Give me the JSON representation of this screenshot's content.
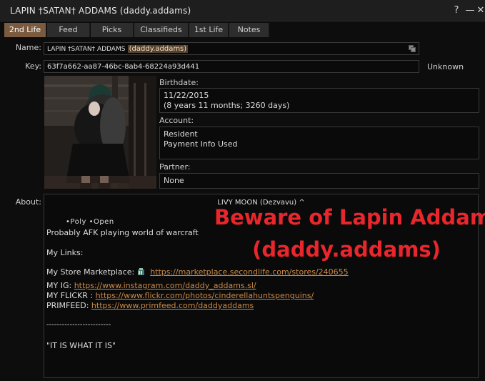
{
  "window": {
    "title": "LAPIN †SATAN† ADDAMS  (daddy.addams)",
    "help_glyph": "?",
    "minimize_glyph": "—",
    "close_glyph": "✕"
  },
  "tabs": [
    {
      "label": "2nd Life",
      "active": true
    },
    {
      "label": "Feed"
    },
    {
      "label": "Picks"
    },
    {
      "label": "Classifieds"
    },
    {
      "label": "1st Life"
    },
    {
      "label": "Notes"
    }
  ],
  "profile": {
    "name_label": "Name:",
    "name_display": "LAPIN †SATAN† ADDAMS",
    "name_user": "(daddy.addams)",
    "key_label": "Key:",
    "key_value": "63f7a662-aa87-46bc-8ab4-68224a93d441",
    "online_status": "Unknown",
    "birthdate_label": "Birthdate:",
    "birthdate_line1": "11/22/2015",
    "birthdate_line2": "(8 years 11 months; 3260 days)",
    "account_label": "Account:",
    "account_line1": "Resident",
    "account_line2": "Payment Info Used",
    "partner_label": "Partner:",
    "partner_value": "None",
    "about_label": "About:"
  },
  "about": {
    "header": "LIVY MOON (Dezvavu) ^",
    "tags": "•Poly •Open",
    "line_afk": "Probably AFK playing world of warcraft",
    "links_heading": "My Links:",
    "store_label": "My Store Marketplace:",
    "store_url": "https://marketplace.secondlife.com/stores/240655",
    "ig_label": "MY IG:",
    "ig_url": "https://www.instagram.com/daddy_addams.sl/",
    "flickr_label": "MY FLICKR :",
    "flickr_url": "https://www.flickr.com/photos/cinderellahuntspenguins/",
    "primfeed_label": "PRIMFEED:",
    "primfeed_url": "https://www.primfeed.com/daddyaddams",
    "divider": "-------------------------",
    "quote": "\"IT IS WHAT IT IS\""
  },
  "overlay": {
    "warning_line1": "Beware of Lapin Addams",
    "warning_line2": "(daddy.addams)",
    "color": "#e8262b"
  },
  "colors": {
    "active_tab": "#7a5b3f",
    "link": "#c88a4a"
  }
}
